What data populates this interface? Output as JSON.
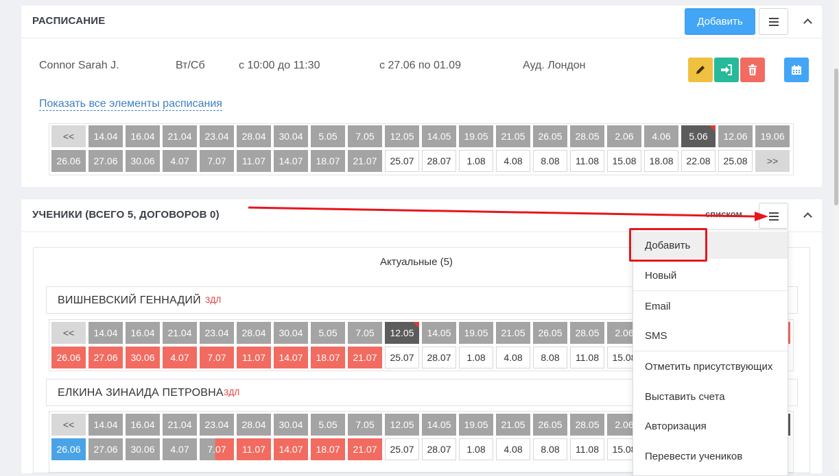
{
  "schedule": {
    "title": "РАСПИСАНИЕ",
    "add_label": "Добавить",
    "row": {
      "teacher": "Connor Sarah J.",
      "days": "Вт/Сб",
      "time": "с 10:00 до 11:30",
      "period": "с 27.06 по 01.09",
      "room": "Ауд. Лондон"
    },
    "show_all": "Показать все элементы расписания",
    "dates_row1": [
      "<<",
      "14.04",
      "16.04",
      "21.04",
      "23.04",
      "28.04",
      "30.04",
      "5.05",
      "7.05",
      "12.05",
      "14.05",
      "19.05",
      "21.05",
      "26.05",
      "28.05",
      "2.06",
      "4.06",
      "5.06",
      "12.06",
      "19.06"
    ],
    "dates_row2": [
      "26.06",
      "27.06",
      "30.06",
      "4.07",
      "7.07",
      "11.07",
      "14.07",
      "18.07",
      "21.07",
      "25.07",
      "28.07",
      "1.08",
      "4.08",
      "8.08",
      "11.08",
      "15.08",
      "18.08",
      "22.08",
      "25.08",
      ">>"
    ]
  },
  "students": {
    "title": "УЧЕНИКИ (ВСЕГО 5, ДОГОВОРОВ 0)",
    "view_label": "списком",
    "group_label": "Актуальные (5)",
    "list": [
      {
        "name": "ВИШНЕВСКИЙ ГЕННАДИЙ",
        "badge": "ЗДЛ",
        "dates_row1": [
          "<<",
          "14.04",
          "16.04",
          "21.04",
          "23.04",
          "28.04",
          "30.04",
          "5.05",
          "7.05",
          "12.05",
          "14.05",
          "19.05",
          "21.05",
          "26.05",
          "28.05",
          "2.06"
        ],
        "dates_row2": [
          "26.06",
          "27.06",
          "30.06",
          "4.07",
          "7.07",
          "11.07",
          "14.07",
          "18.07",
          "21.07",
          "25.07",
          "28.07",
          "1.08",
          "4.08",
          "8.08",
          "11.08",
          "15.08"
        ]
      },
      {
        "name": "ЕЛКИНА ЗИНАИДА ПЕТРОВНА",
        "badge": "ЗДЛ",
        "dates_row1": [
          "<<",
          "14.04",
          "16.04",
          "21.04",
          "23.04",
          "28.04",
          "30.04",
          "5.05",
          "7.05",
          "12.05",
          "14.05",
          "19.05",
          "21.05",
          "26.05",
          "28.05",
          "2.06"
        ],
        "dates_row2": [
          "26.06",
          "27.06",
          "30.06",
          "4.07",
          "7.07",
          "11.07",
          "14.07",
          "18.07",
          "21.07",
          "25.07",
          "28.07",
          "1.08",
          "4.08",
          "8.08",
          "11.08",
          "15.08"
        ]
      }
    ]
  },
  "menu": {
    "items": [
      "Добавить",
      "Новый",
      "Email",
      "SMS",
      "Отметить присутствующих",
      "Выставить счета",
      "Авторизация",
      "Перевести учеников"
    ]
  },
  "colors": {
    "primary": "#42a5f5",
    "warning": "#f0c040",
    "success": "#26b99a",
    "danger": "#f26b60",
    "highlight": "#e8141a"
  }
}
